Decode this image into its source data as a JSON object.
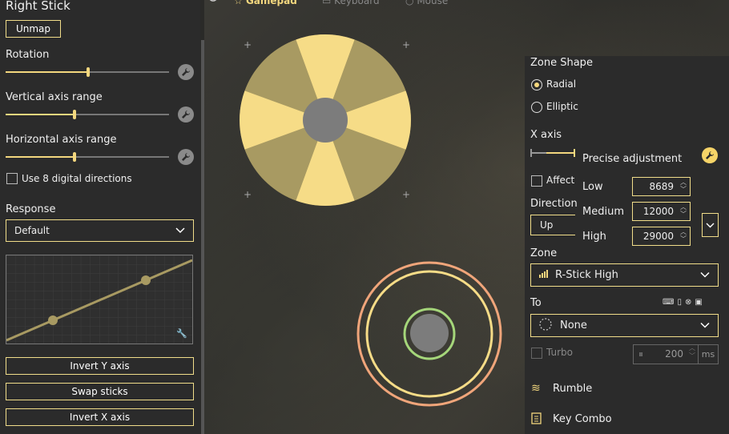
{
  "top_tabs": {
    "gamepad": "Gamepad",
    "keyboard": "Keyboard",
    "mouse": "Mouse"
  },
  "left": {
    "title": "Right Stick",
    "unmap": "Unmap",
    "rotation": "Rotation",
    "rotation_value": 0.5,
    "vertical": "Vertical axis range",
    "vertical_value": 0.41,
    "horizontal": "Horizontal axis range",
    "horizontal_value": 0.41,
    "eight_dir": "Use 8 digital directions",
    "response": "Response",
    "response_value": "Default",
    "invert_y": "Invert Y axis",
    "swap": "Swap sticks",
    "invert_x": "Invert X axis"
  },
  "right": {
    "zone_shape": "Zone Shape",
    "radial": "Radial",
    "elliptic": "Elliptic",
    "x_axis": "X axis",
    "precise": "Precise adjustment",
    "affect": "Affect",
    "direction": "Direction",
    "direction_value": "Up",
    "low": "Low",
    "low_value": "8689",
    "medium": "Medium",
    "medium_value": "12000",
    "high": "High",
    "high_value": "29000",
    "zone": "Zone",
    "zone_value": "R-Stick High",
    "to": "To",
    "to_value": "None",
    "turbo": "Turbo",
    "turbo_value": "200",
    "turbo_unit": "ms",
    "rumble": "Rumble",
    "key_combo": "Key Combo"
  },
  "colors": {
    "accent": "#f3d77e",
    "ring_orange": "#f0a57a",
    "ring_green": "#a5d67a"
  }
}
